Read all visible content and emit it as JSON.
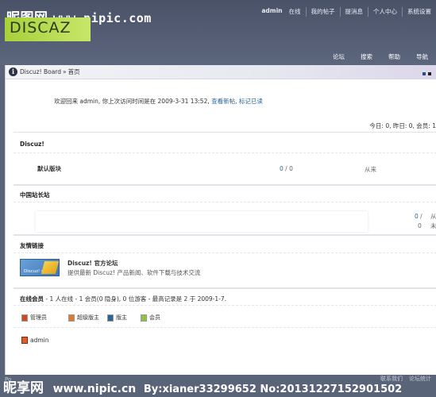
{
  "watermark": {
    "site_cn": "昵图网",
    "site_url": "www.nipic.com",
    "bottom_cn": "昵享网",
    "bottom_url": "www.nipic.cn",
    "bottom_by": "By:xianer33299652 No:20131227152901502"
  },
  "logo": "DISCAZ",
  "topnav": [
    "admin",
    "在线",
    "我的帖子",
    "提消息",
    "个人中心",
    "系统设置"
  ],
  "mainnav": [
    "论坛",
    "搜索",
    "帮助",
    "导航"
  ],
  "breadcrumb": {
    "board": "Discuz! Board",
    "sep": "»",
    "current": "首页"
  },
  "welcome": {
    "text": "欢迎回来  admin, 你上次访问时间是在  2009-3-31 13:52,",
    "link1": "查看新帖",
    "sep": ",",
    "link2": "标记已读"
  },
  "stats": "今日: 0, 昨日: 0, 会员: 1",
  "categories": [
    {
      "title": "Discuz!"
    },
    {
      "title": "中国站长站"
    },
    {
      "title": "友情链接"
    }
  ],
  "forum": {
    "name": "默认版块",
    "topics": "0",
    "slash": "/",
    "posts": "0",
    "last": "从来"
  },
  "forum2": {
    "topics": "0",
    "slash": "/",
    "posts": "0",
    "last1": "从",
    "last2": "未"
  },
  "friend_link": {
    "badge": "Discuz! net",
    "title": "Discuz! 官方论坛",
    "desc": "提供最新  Discuz! 产品新闻、软件下载与技术交流"
  },
  "online": {
    "label": "在线会员",
    "text": "- 1 人在线  - 1 会员(0 隐身), 0 位游客  - 最高记录是  2 于  2009-1-7."
  },
  "legend": [
    {
      "label": "管理员",
      "color": "#d24a24"
    },
    {
      "label": "超级版主",
      "color": "#e07a2a"
    },
    {
      "label": "版主",
      "color": "#2a6496"
    },
    {
      "label": "会员",
      "color": "#8ac440"
    }
  ],
  "online_user": "admin",
  "footer": {
    "po": "Po",
    "links": [
      "联系我们",
      "论坛统计"
    ]
  }
}
